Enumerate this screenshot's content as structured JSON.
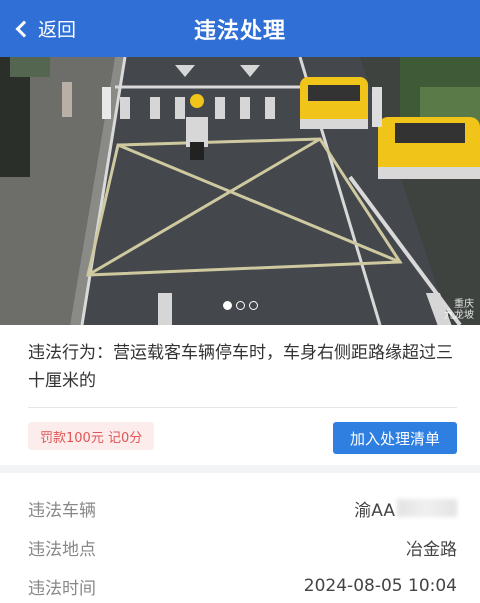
{
  "header": {
    "back_label": "返回",
    "title": "违法处理"
  },
  "photo": {
    "carousel": {
      "count": 3,
      "active_index": 0
    },
    "watermark_line1": "重庆",
    "watermark_line2": "九龙坡"
  },
  "violation": {
    "text": "违法行为：营运载客车辆停车时，车身右侧距路缘超过三十厘米的",
    "fine_badge": "罚款100元 记0分",
    "add_button": "加入处理清单"
  },
  "details": {
    "rows": [
      {
        "label": "违法车辆",
        "value": "渝AA"
      },
      {
        "label": "违法地点",
        "value": "冶金路"
      },
      {
        "label": "违法时间",
        "value": "2024-08-05 10:04"
      }
    ]
  },
  "colors": {
    "header": "#2f6fd6",
    "button": "#2f7fe0",
    "fine_text": "#e05555",
    "fine_bg": "#fdecec",
    "taxi": "#f0c419"
  }
}
